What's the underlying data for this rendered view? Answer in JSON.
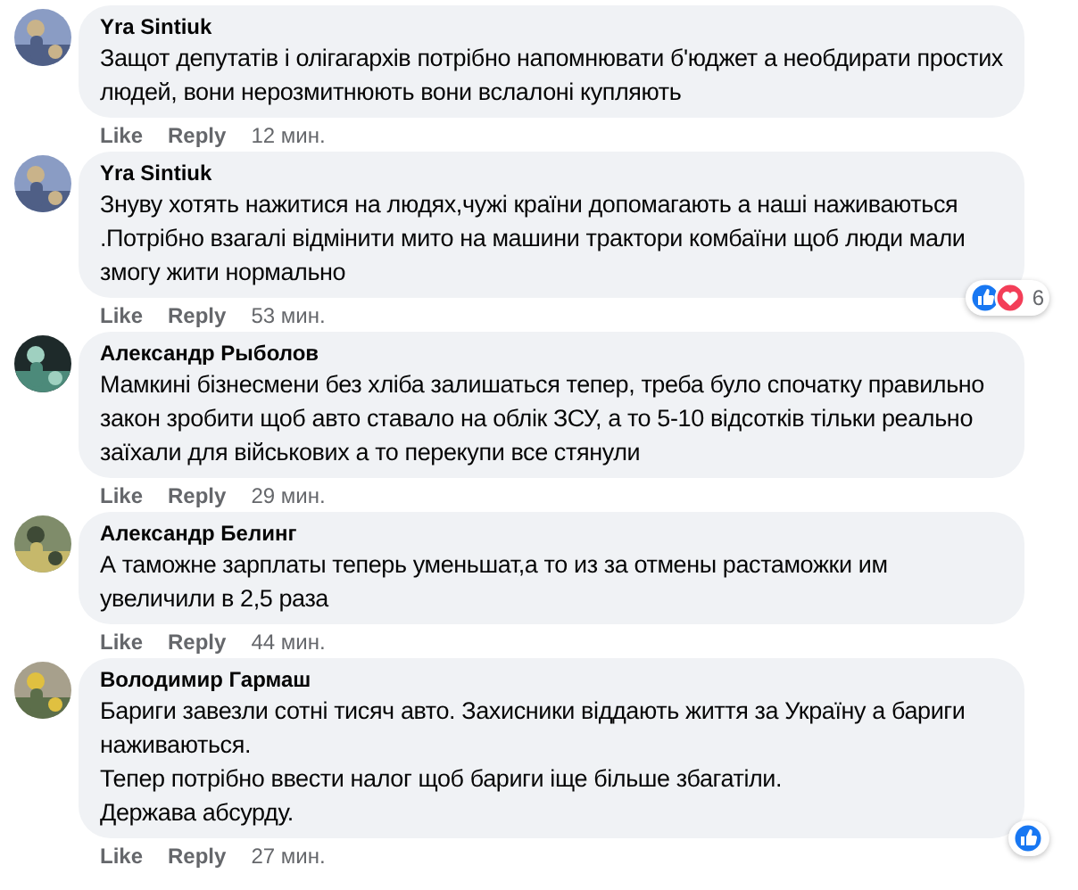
{
  "comments": [
    {
      "author": "Yra Sintiuk",
      "paragraphs": [
        "Защот депутатів і олігагархів потрібно напомнювати б'юджет а необдирати простих людей, вони нерозмитнюють вони вслалоні купляють"
      ],
      "actions": [
        "Like",
        "Reply"
      ],
      "time": "12 мин."
    },
    {
      "author": "Yra Sintiuk",
      "paragraphs": [
        "Знуву хотять нажитися на людях,чужі країни допомагають а наші наживаються .Потрібно взагалі відмінити мито на машини трактори комбаїни щоб люди мали змогу жити нормально"
      ],
      "actions": [
        "Like",
        "Reply"
      ],
      "time": "53 мин.",
      "reactions": [
        {
          "kind": "like"
        },
        {
          "kind": "love"
        }
      ],
      "reaction_count": "6"
    },
    {
      "author": "Александр Рыболов",
      "paragraphs": [
        "Мамкині бізнесмени без хліба залишаться тепер, треба було спочатку правильно закон зробити щоб авто ставало на облік ЗСУ, а то 5-10 відсотків тільки реально заїхали для військових а то перекупи все стянули"
      ],
      "actions": [
        "Like",
        "Reply"
      ],
      "time": "29 мин."
    },
    {
      "author": "Александр Белинг",
      "paragraphs": [
        "А таможне зарплаты теперь уменьшат,а то из за отмены растаможки им увеличили в 2,5 раза"
      ],
      "actions": [
        "Like",
        "Reply"
      ],
      "time": "44 мин."
    },
    {
      "author": "Володимир Гармаш",
      "paragraphs": [
        "Бариги завезли сотні тисяч авто. Захисники віддають життя за Україну а бариги наживаються.",
        "Тепер потрібно ввести налог щоб бариги іще більше збагатіли.",
        "Держава абсурду."
      ],
      "actions": [
        "Like",
        "Reply"
      ],
      "time": "27 мин.",
      "reactions": [
        {
          "kind": "like"
        }
      ]
    }
  ]
}
